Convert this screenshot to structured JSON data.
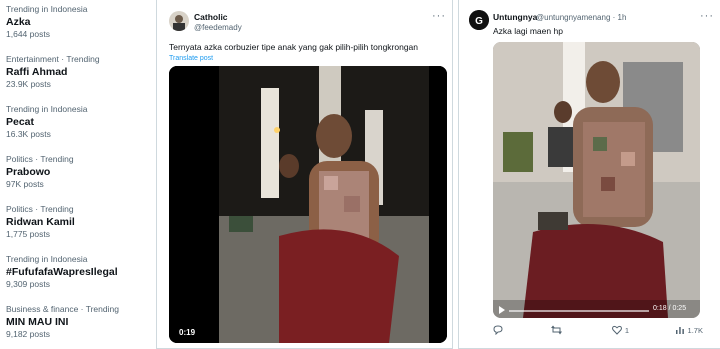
{
  "trends": [
    {
      "context": "Trending in Indonesia",
      "name": "Azka",
      "count": "1,644 posts"
    },
    {
      "context": "Entertainment · Trending",
      "name": "Raffi Ahmad",
      "count": "23.9K posts"
    },
    {
      "context": "Trending in Indonesia",
      "name": "Pecat",
      "count": "16.3K posts"
    },
    {
      "context": "Politics · Trending",
      "name": "Prabowo",
      "count": "97K posts"
    },
    {
      "context": "Politics · Trending",
      "name": "Ridwan Kamil",
      "count": "1,775 posts"
    },
    {
      "context": "Trending in Indonesia",
      "name": "#FufufafaWapresIlegal",
      "count": "9,309 posts"
    },
    {
      "context": "Business & finance · Trending",
      "name": "MIN MAU INI",
      "count": "9,182 posts"
    }
  ],
  "tweet1": {
    "author": "Catholic",
    "handle": "@feedemady",
    "text": "Ternyata azka corbuzier tipe anak yang gak pilih-pilih tongkrongan",
    "translate": "Translate post",
    "duration": "0:19",
    "more": "···"
  },
  "tweet2": {
    "author": "Untungnya",
    "handle": "@untungnyamenang · 1h",
    "text": "Azka lagi maen hp",
    "more": "···",
    "video_time": "0:18 / 0:25",
    "stats": {
      "reply": "",
      "retweet": "",
      "like": "1",
      "views": "1.7K"
    }
  },
  "colors": {
    "accent": "#1d9bf0",
    "muted": "#536471",
    "border": "#cfd9de"
  }
}
